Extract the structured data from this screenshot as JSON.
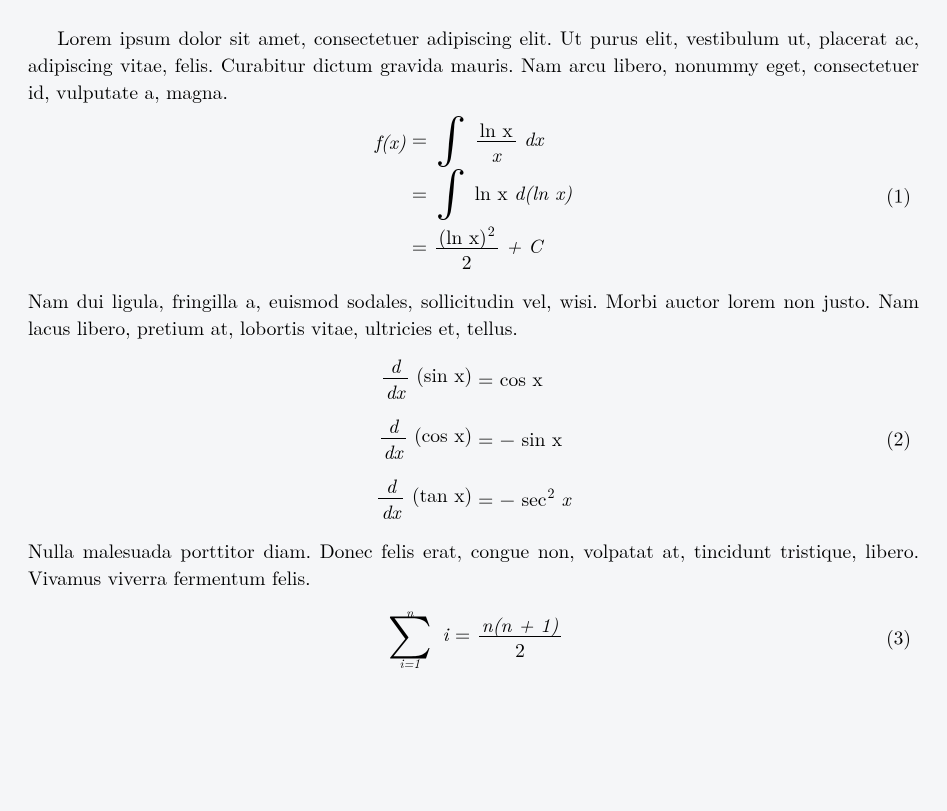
{
  "paragraphs": {
    "p1": "Lorem ipsum dolor sit amet, consectetuer adipiscing elit. Ut purus elit, vestibulum ut, placerat ac, adipiscing vitae, felis. Curabitur dictum gravida mauris. Nam arcu libero, nonummy eget, consectetuer id, vulputate a, magna.",
    "p2": "Nam dui ligula, fringilla a, euismod sodales, sollicitudin vel, wisi. Morbi auctor lorem non justo. Nam lacus libero, pretium at, lobortis vitae, ultricies et, tellus.",
    "p3": "Nulla malesuada porttitor diam. Donec felis erat, congue non, volpatat at, tincidunt tristique, libero. Vivamus viverra fermentum felis."
  },
  "eq1": {
    "number": "(1)",
    "lhs0": "f(x)",
    "integrand_num": "ln x",
    "integrand_den": "x",
    "dx": "dx",
    "line2_integrand": "ln x",
    "line2_diff": "d(ln x)",
    "line3_num_base": "(ln x)",
    "line3_num_exp": "2",
    "line3_den": "2",
    "plusC": "+ C"
  },
  "eq2": {
    "number": "(2)",
    "dfrac_num": "d",
    "dfrac_den": "dx",
    "f1": "(sin x)",
    "r1": "= cos x",
    "f2": "(cos x)",
    "r2a": "= −",
    "r2b": "sin x",
    "f3": "(tan x)",
    "r3a": "= −",
    "r3b": "sec",
    "r3exp": "2",
    "r3x": " x"
  },
  "eq3": {
    "number": "(3)",
    "top": "n",
    "bot": "i=1",
    "term": "i",
    "rhs_num": "n(n + 1)",
    "rhs_den": "2"
  }
}
